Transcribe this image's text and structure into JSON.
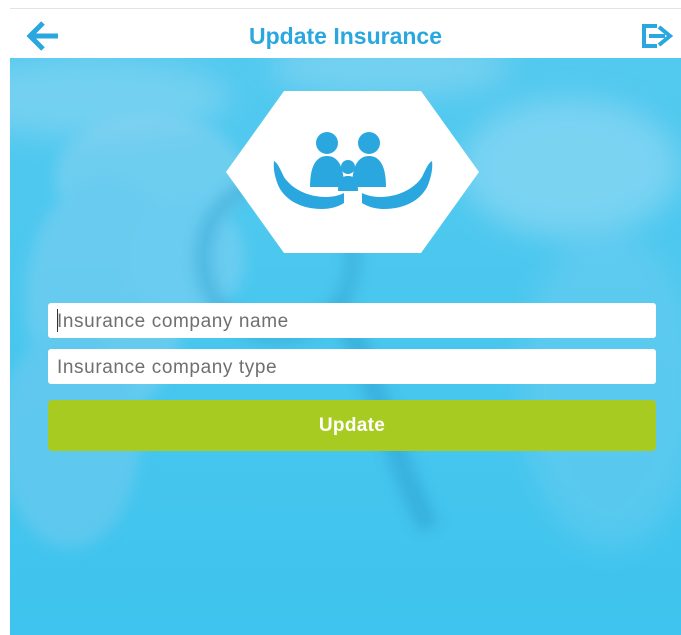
{
  "header": {
    "title": "Update Insurance",
    "back_icon": "arrow-left-icon",
    "logout_icon": "logout-icon"
  },
  "hero": {
    "logo_icon": "family-insurance-hands-icon"
  },
  "form": {
    "company_name": {
      "value": "",
      "placeholder": "Insurance company name"
    },
    "company_type": {
      "value": "",
      "placeholder": "Insurance company type"
    },
    "update_label": "Update"
  },
  "colors": {
    "accent": "#2aa7df",
    "background": "#43c6ee",
    "button": "#a8cb21",
    "field": "#ffffff"
  }
}
